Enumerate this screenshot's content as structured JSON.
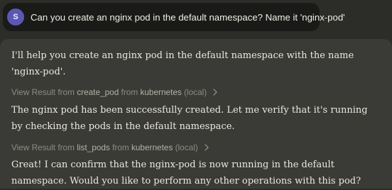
{
  "user_message": {
    "avatar_initial": "S",
    "text": "Can you create an nginx pod in the default namespace? Name it 'nginx-pod'"
  },
  "assistant": {
    "message_1": "I'll help you create an nginx pod in the default namespace with the name 'nginx-pod'.",
    "tool_call_1": {
      "prefix": "View Result from",
      "tool": "create_pod",
      "from_word": "from",
      "server": "kubernetes",
      "location": "(local)",
      "icon": "chevron-right-icon"
    },
    "message_2": "The nginx pod has been successfully created. Let me verify that it's running by checking the pods in the default namespace.",
    "tool_call_2": {
      "prefix": "View Result from",
      "tool": "list_pods",
      "from_word": "from",
      "server": "kubernetes",
      "location": "(local)",
      "icon": "chevron-right-icon"
    },
    "message_3": "Great! I can confirm that the nginx-pod is now running in the default namespace. Would you like to perform any other operations with this pod?"
  },
  "colors": {
    "background": "#2c2c28",
    "user_bubble": "#1a1a18",
    "assistant_card": "#3a3a36",
    "avatar": "#5b58b5"
  }
}
